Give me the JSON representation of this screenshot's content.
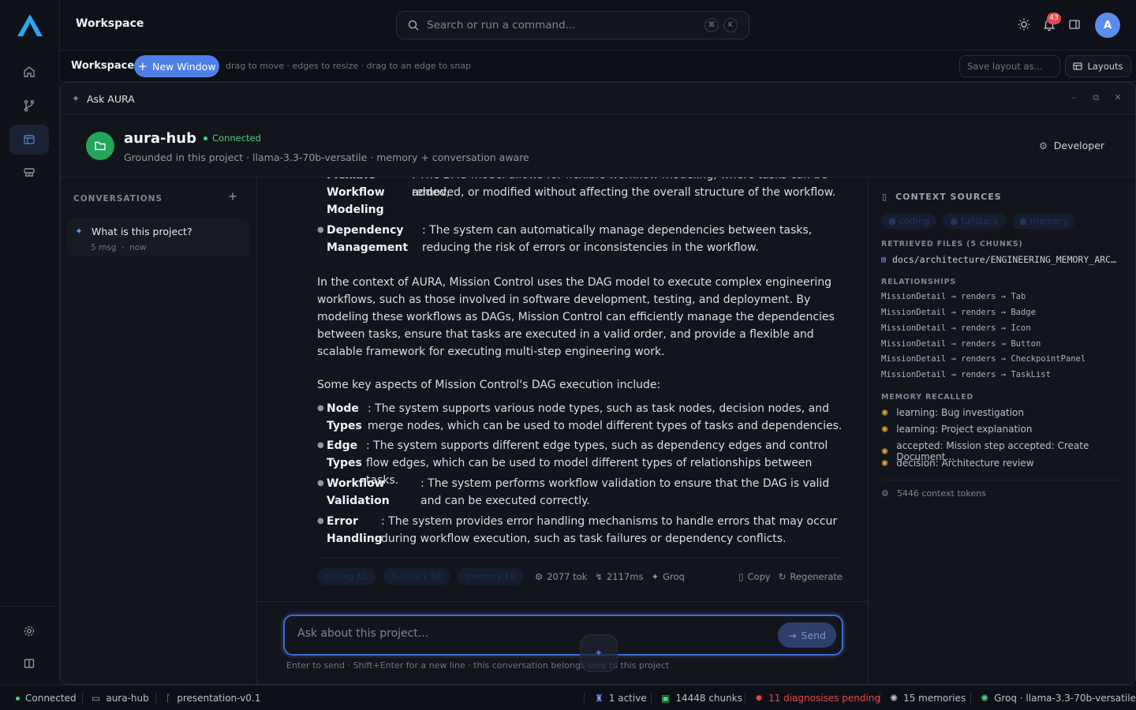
{
  "app": {
    "title": "Workspace",
    "search_placeholder": "Search or run a command...",
    "kbd": [
      "⌘",
      "K"
    ],
    "notification_count": "43",
    "avatar_initial": "A"
  },
  "workspace_bar": {
    "label": "Workspace",
    "new_window": "New Window",
    "hint": "drag to move · edges to resize · drag to an edge to snap",
    "save_placeholder": "Save layout as...",
    "layouts": "Layouts"
  },
  "window": {
    "title": "Ask AURA",
    "project_name": "aura-hub",
    "status": "Connected",
    "subtitle": "Grounded in this project · llama-3.3-70b-versatile · memory + conversation aware",
    "developer": "Developer"
  },
  "conversations": {
    "heading": "CONVERSATIONS",
    "items": [
      {
        "title": "What is this project?",
        "count": "5 msg",
        "time": "now"
      }
    ]
  },
  "chat": {
    "cut_line": ": The DAG model allows for flexible workflow modeling, where tasks can be added,",
    "top_items": [
      {
        "term": "Flexible Workflow Modeling",
        "term_lines": [
          "Workflow",
          "Modeling"
        ],
        "desc": "removed, or modified without affecting the overall structure of the workflow."
      },
      {
        "term_lines": [
          "Dependency",
          "Management"
        ],
        "desc": ": The system can automatically manage dependencies between tasks, reducing the risk of errors or inconsistencies in the workflow."
      }
    ],
    "paragraph": "In the context of AURA, Mission Control uses the DAG model to execute complex engineering workflows, such as those involved in software development, testing, and deployment. By modeling these workflows as DAGs, Mission Control can efficiently manage the dependencies between tasks, ensure that tasks are executed in a valid order, and provide a flexible and scalable framework for executing multi-step engineering work.",
    "intro": "Some key aspects of Mission Control's DAG execution include:",
    "aspects": [
      {
        "term_lines": [
          "Node",
          "Types"
        ],
        "desc": ": The system supports various node types, such as task nodes, decision nodes, and merge nodes, which can be used to model different types of tasks and dependencies."
      },
      {
        "term_lines": [
          "Edge",
          "Types"
        ],
        "desc": ": The system supports different edge types, such as dependency edges and control flow edges, which can be used to model different types of relationships between tasks."
      },
      {
        "term_lines": [
          "Workflow",
          "Validation"
        ],
        "desc": ": The system performs workflow validation to ensure that the DAG is valid and can be executed correctly."
      },
      {
        "term_lines": [
          "Error",
          "Handling"
        ],
        "desc": ": The system provides error handling mechanisms to handle errors that may occur during workflow execution, such as task failures or dependency conflicts."
      }
    ],
    "footer": {
      "tags": [
        "coding KE",
        "fullstack KE",
        "memory KE"
      ],
      "tokens": "2077 tok",
      "latency": "2117ms",
      "provider": "Groq",
      "copy": "Copy",
      "regenerate": "Regenerate"
    }
  },
  "composer": {
    "placeholder": "Ask about this project...",
    "send": "Send",
    "hint": "Enter to send · Shift+Enter for a new line · this conversation belongs only to this project"
  },
  "context": {
    "heading": "CONTEXT SOURCES",
    "tags": [
      "coding",
      "fullstack",
      "memory"
    ],
    "files_heading": "RETRIEVED FILES (5 CHUNKS)",
    "file": "docs/architecture/ENGINEERING_MEMORY_ARC…",
    "relationships_heading": "RELATIONSHIPS",
    "relationships": [
      "MissionDetail → renders → Tab",
      "MissionDetail → renders → Badge",
      "MissionDetail → renders → Icon",
      "MissionDetail → renders → Button",
      "MissionDetail → renders → CheckpointPanel",
      "MissionDetail → renders → TaskList"
    ],
    "memory_heading": "MEMORY RECALLED",
    "memories": [
      "learning: Bug investigation",
      "learning: Project explanation",
      "accepted: Mission step accepted: Create Document…",
      "decision: Architecture review"
    ],
    "tokens": "5446 context tokens"
  },
  "status": {
    "connected": "Connected",
    "project": "aura-hub",
    "branch": "presentation-v0.1",
    "active": "1 active",
    "chunks": "14448 chunks",
    "diagnoses": "11 diagnosises pending",
    "memories": "15 memories",
    "model": "Groq · llama-3.3-70b-versatile"
  },
  "colors": {
    "accent": "#4f7fe6",
    "success": "#4bd17e",
    "danger": "#e5484d",
    "memory": "#d9a23f"
  }
}
